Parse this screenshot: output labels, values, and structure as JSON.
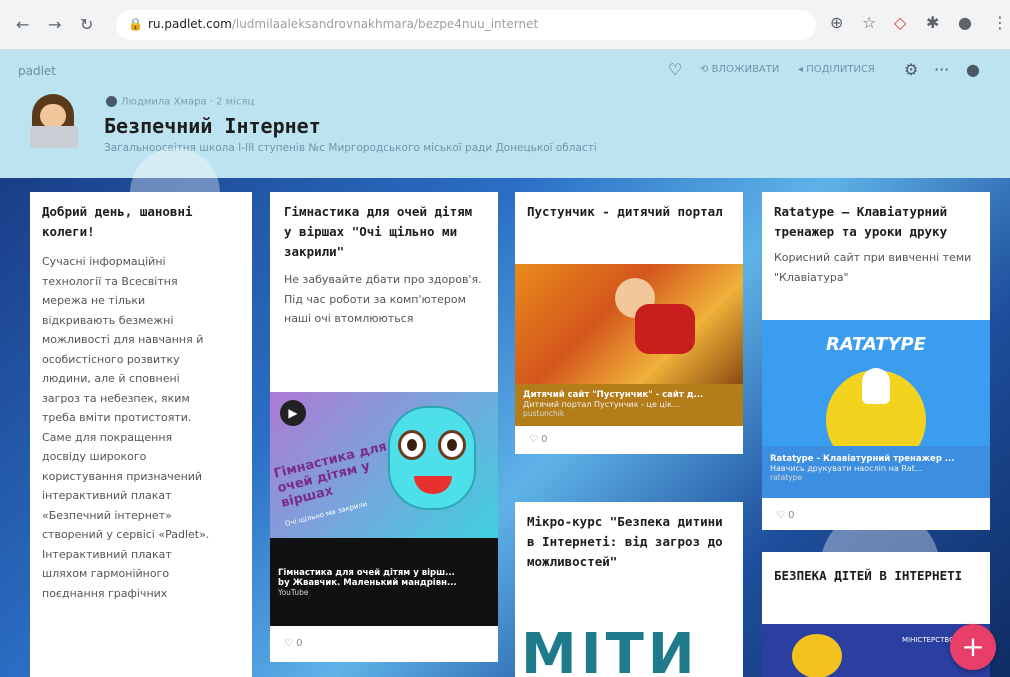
{
  "browser": {
    "url_domain": "ru.padlet.com",
    "url_path": "/ludmilaaleksandrovnakhmara/bezpe4nuu_internet"
  },
  "padlet": {
    "logo": "padlet",
    "author": "Людмила Хмара · 2 місяц",
    "title": "Безпечний Інтернет",
    "subtitle": "Загальноосвітня школа І-ІІІ ступенів №с Миргородського міської ради Донецької області",
    "actions": {
      "remake": "ВЛОЖИВАТИ",
      "share": "ПОДІЛИТИСЯ"
    }
  },
  "cards": {
    "c1": {
      "title": "Добрий день, шановні колеги!",
      "lines": [
        "Сучасні інформаційні",
        "технології та Всесвітня",
        "мережа не тільки",
        "відкривають безмежні",
        "можливості для навчання й",
        "особистісного розвитку",
        "людини, але й сповнені",
        "загроз та небезпек, яким",
        "треба вміти протистояти.",
        "Саме для покращення",
        "досвіду широкого",
        "користування призначений",
        "інтерактивний плакат",
        "«Безпечний інтернет»",
        "створений у сервісі «Padlet».",
        "Інтерактивний плакат",
        "шляхом гармонійного",
        "поєднання графічних"
      ]
    },
    "c2": {
      "title": "Гімнастика для очей дітям у віршах \"Очі щільно ми закрили\"",
      "text": "Не забувайте дбати про здоров'я. Під час роботи за комп'ютером наші очі втомлюються",
      "thumb_text": "Гімнастика для очей дітям у віршах",
      "thumb_sub": "Очі щільно ми закрили",
      "link_title": "Гімнастика для очей дітям у вірш...",
      "link_sub": "by Жвавчик. Маленький мандрівн...",
      "link_meta": "YouTube",
      "likes": "0"
    },
    "c3": {
      "title": "Пустунчик - дитячий портал",
      "link_title": "Дитячий сайт \"Пустунчик\" - сайт д...",
      "link_sub": "Дитячий портал Пустунчик - це цік...",
      "link_meta": "pustunchik",
      "likes": "0"
    },
    "c4": {
      "title": "Мікро-курс \"Безпека дитини в Інтернеті: від загроз до можливостей\"",
      "big_text": "МІТИ"
    },
    "c5": {
      "title": "Ratatype — Клавіатурний тренажер та уроки друку",
      "text": "Корисний сайт при вивченні теми \"Клавіатура\"",
      "brand": "RATATYPE",
      "link_title": "Ratatype - Клавіатурний тренажер ...",
      "link_sub": "Навчись друкувати наосліп на Rat...",
      "link_meta": "ratatype",
      "likes": "0"
    },
    "c6": {
      "title": "БЕЗПЕКА ДІТЕЙ В ІНТЕРНЕТІ",
      "thumb_text": "МІНІСТЕРСТВО"
    }
  },
  "fab": "+",
  "colors": {
    "header_bg": "#bde3f0",
    "fab": "#e83e6a",
    "c3_link_bg": "#b47d1a",
    "c5_link_bg": "#3b8ee0"
  }
}
